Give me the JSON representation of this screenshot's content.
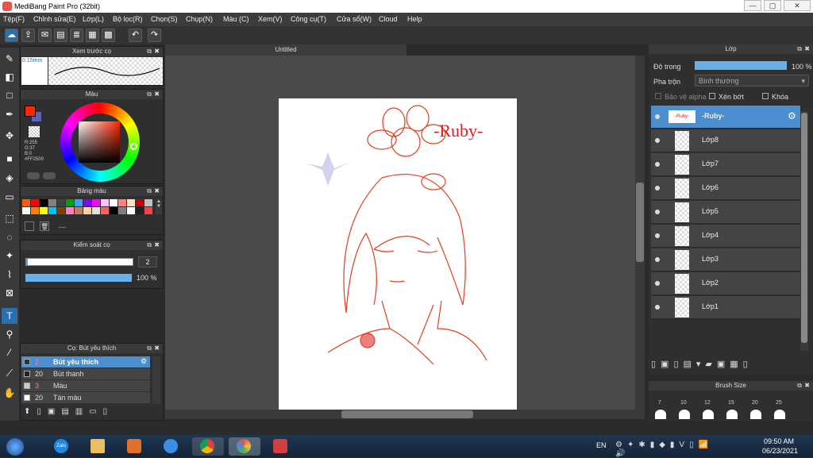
{
  "window": {
    "title": "MediBang Paint Pro (32bit)",
    "min": "—",
    "max": "▢",
    "close": "✕"
  },
  "menu": [
    "Tệp(F)",
    "Chỉnh sửa(E)",
    "Lớp(L)",
    "Bộ lọc(R)",
    "Chọn(S)",
    "Chụp(N)",
    "Màu (C)",
    "Xem(V)",
    "Công cụ(T)",
    "Cửa sổ(W)",
    "Cloud",
    "Help"
  ],
  "doc": {
    "tab": "Untitled"
  },
  "brush_preview": {
    "title": "Xem trước cọ",
    "size": "0.15mm"
  },
  "color": {
    "title": "Màu",
    "r": "R:255",
    "g": "G:37",
    "b": "B:0",
    "hex": "#FF2500",
    "primary": "#ff2500",
    "secondary": "#6060c0"
  },
  "palette": {
    "title": "Bảng màu",
    "swatches": [
      "#ff5a00",
      "#ff0000",
      "#000000",
      "#808080",
      "#404040",
      "#00a000",
      "#40a0ff",
      "#8000ff",
      "#ff00ff",
      "#ffc0ff",
      "#ffffff",
      "#ff8080",
      "#ffe0c0",
      "#c00000",
      "#c0c0c0",
      "#ffffff",
      "#ff8000",
      "#ffff00",
      "#00c0ff",
      "#804000",
      "#ff80c0",
      "#c08060",
      "#ffd0a0",
      "#e0e0e0",
      "#ff6060",
      "#000000",
      "#808080",
      "#ffffff",
      "#202020",
      "#ff4040"
    ],
    "extra": "---"
  },
  "brush_control": {
    "title": "Kiểm soát cọ",
    "size": "2",
    "opacity": "100 %"
  },
  "brushes": {
    "title": "Cọ: Bút yêu thích",
    "items": [
      {
        "size": "2",
        "name": "Bút yêu thích"
      },
      {
        "size": "20",
        "name": "Bút thanh"
      },
      {
        "size": "3",
        "name": "Màu"
      },
      {
        "size": "20",
        "name": "Tán màu"
      }
    ]
  },
  "layers": {
    "title": "Lớp",
    "opacity_label": "Độ trong",
    "opacity_value": "100 %",
    "blend_label": "Pha trộn",
    "blend_value": "Bình thường",
    "protect_alpha": "Bảo vệ alpha",
    "clipping": "Xén bớt",
    "lock": "Khóa",
    "selected": "-Ruby-",
    "items": [
      "Lớp8",
      "Lớp7",
      "Lớp6",
      "Lớp5",
      "Lớp4",
      "Lớp3",
      "Lớp2",
      "Lớp1"
    ]
  },
  "brush_size": {
    "title": "Brush Size",
    "sizes": [
      "7",
      "10",
      "12",
      "15",
      "20",
      "25"
    ]
  },
  "canvas_text": "-Ruby-",
  "taskbar": {
    "lang": "EN",
    "time": "09:50 AM",
    "date": "06/23/2021",
    "zalo": "Zalo"
  }
}
